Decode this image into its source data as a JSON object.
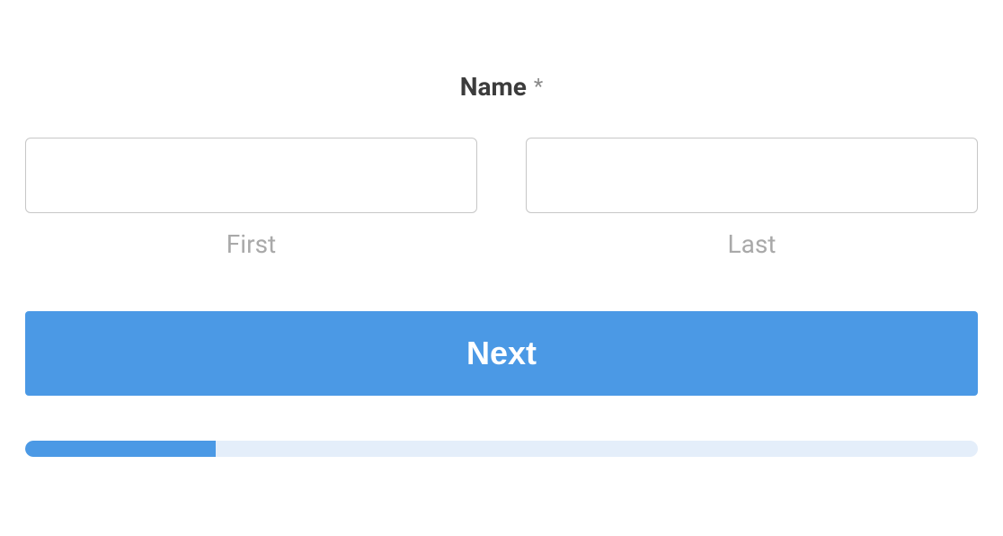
{
  "form": {
    "field_label": "Name",
    "required_mark": "*",
    "first_name": {
      "value": "",
      "sub_label": "First"
    },
    "last_name": {
      "value": "",
      "sub_label": "Last"
    },
    "next_button_label": "Next",
    "progress_percent": 20
  },
  "colors": {
    "primary": "#4b99e5",
    "progress_track": "#e4eefa",
    "label_text": "#3c3c3c",
    "muted_text": "#a9a9a9",
    "input_border": "#c7c7c7"
  }
}
